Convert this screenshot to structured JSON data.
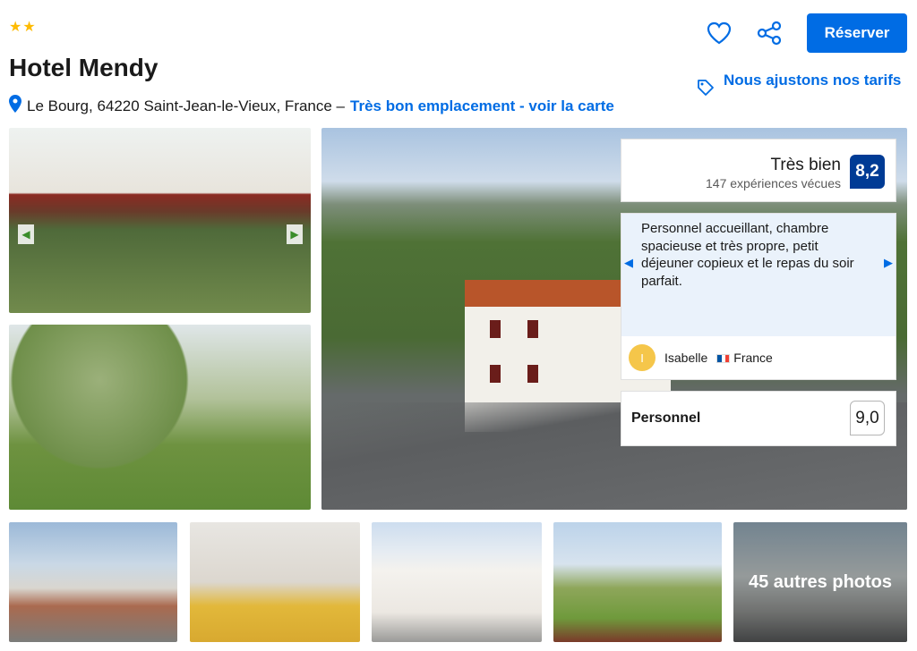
{
  "header": {
    "stars": "★★",
    "title": "Hotel Mendy",
    "address": "Le Bourg, 64220 Saint-Jean-le-Vieux, France –",
    "map_link": "Très bon emplacement - voir la carte"
  },
  "actions": {
    "reserve_label": "Réserver",
    "price_match_label": "Nous ajustons nos tarifs",
    "icons": [
      "heart-icon",
      "share-icon",
      "tag-icon",
      "location-pin-icon"
    ]
  },
  "rating": {
    "verdict": "Très bien",
    "experiences": "147 expériences vécues",
    "score": "8,2"
  },
  "review": {
    "text": "Personnel accueillant, chambre spacieuse et très propre, petit déjeuner copieux et le repas du soir parfait.",
    "author_initial": "I",
    "author_name": "Isabelle",
    "author_country": "France"
  },
  "category": {
    "name": "Personnel",
    "score": "9,0"
  },
  "gallery": {
    "more_photos": "45 autres photos"
  },
  "colors": {
    "accent": "#006ce4",
    "score_badge": "#003b95",
    "stars": "#febb02"
  }
}
